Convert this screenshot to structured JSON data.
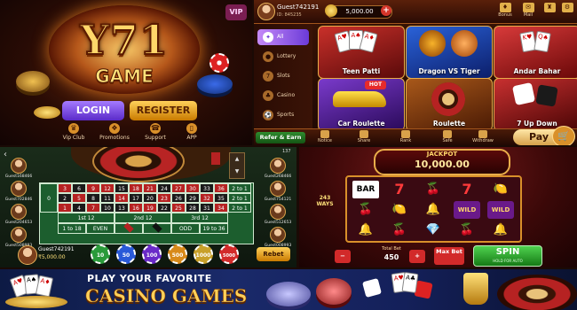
{
  "login_panel": {
    "logo_top": "Y71",
    "logo_bottom": "GAME",
    "vip": "VIP",
    "login_label": "LOGIN",
    "register_label": "REGISTER",
    "nav": [
      {
        "label": "Vip Club",
        "icon": "crown-icon"
      },
      {
        "label": "Promotions",
        "icon": "gift-icon"
      },
      {
        "label": "Support",
        "icon": "headset-icon"
      },
      {
        "label": "APP",
        "icon": "phone-icon"
      }
    ]
  },
  "lobby": {
    "user_name": "Guest742191",
    "user_id": "ID: 845235",
    "balance": "5,000.00",
    "top_icons": [
      {
        "label": "Bonus",
        "icon": "bonus-icon"
      },
      {
        "label": "Mail",
        "icon": "mail-icon"
      },
      {
        "label": "",
        "icon": "trophy-icon"
      },
      {
        "label": "",
        "icon": "settings-icon"
      }
    ],
    "categories": [
      "All",
      "Lottery",
      "Slots",
      "Casino",
      "Sports"
    ],
    "games": [
      {
        "label": "Teen Patti"
      },
      {
        "label": "Dragon VS Tiger"
      },
      {
        "label": "Andar Bahar"
      },
      {
        "label": "Car Roulette",
        "badge": "HOT"
      },
      {
        "label": "Roulette"
      },
      {
        "label": "7 Up Down"
      }
    ],
    "refer_label": "Refer & Earn",
    "bottom_nav": [
      "Notice",
      "Share",
      "Rank",
      "Safe",
      "Withdraw"
    ],
    "pay_label": "Pay"
  },
  "roulette": {
    "top_right_count": "137",
    "numbers_top": [
      "3",
      "6",
      "9",
      "12",
      "15",
      "18",
      "21",
      "24",
      "27",
      "30",
      "33",
      "36"
    ],
    "numbers_mid": [
      "2",
      "5",
      "8",
      "11",
      "14",
      "17",
      "20",
      "23",
      "26",
      "29",
      "32",
      "35"
    ],
    "numbers_bot": [
      "1",
      "4",
      "7",
      "10",
      "13",
      "16",
      "19",
      "22",
      "25",
      "28",
      "31",
      "34"
    ],
    "col_label": "2 to 1",
    "zero": "0",
    "dozens": [
      "1st 12",
      "2nd 12",
      "3rd 12"
    ],
    "outside_bets": [
      "1 to 18",
      "EVEN",
      "",
      "",
      "ODD",
      "19 to 36"
    ],
    "left_players": [
      "Guest168466",
      "Guest702846",
      "Guest204653",
      "Guest508993"
    ],
    "right_players": [
      "Guest268466",
      "Guest754121",
      "Guest512653",
      "Guest008993"
    ],
    "me_name": "Guest742191",
    "me_balance": "₹5,000.00",
    "chips": [
      "10",
      "50",
      "100",
      "500",
      "1000",
      "5000"
    ],
    "rebet_label": "Rebet"
  },
  "slots": {
    "jackpot_title": "JACKPOT",
    "jackpot_value": "10,000.00",
    "ways": "243 WAYS",
    "reels": [
      [
        "BAR",
        "7",
        "🍒",
        "7",
        "🍋"
      ],
      [
        "🍒",
        "🍋",
        "🔔",
        "WILD",
        "WILD"
      ],
      [
        "🔔",
        "🍒",
        "💎",
        "🍒",
        "🔔"
      ]
    ],
    "total_bet_label": "Total Bet",
    "total_bet_value": "450",
    "max_bet_label": "Max Bet",
    "spin_label": "SPIN",
    "spin_sub": "HOLD FOR AUTO"
  },
  "banner": {
    "line1": "PLAY YOUR FAVORITE",
    "line2": "CASINO GAMES"
  }
}
